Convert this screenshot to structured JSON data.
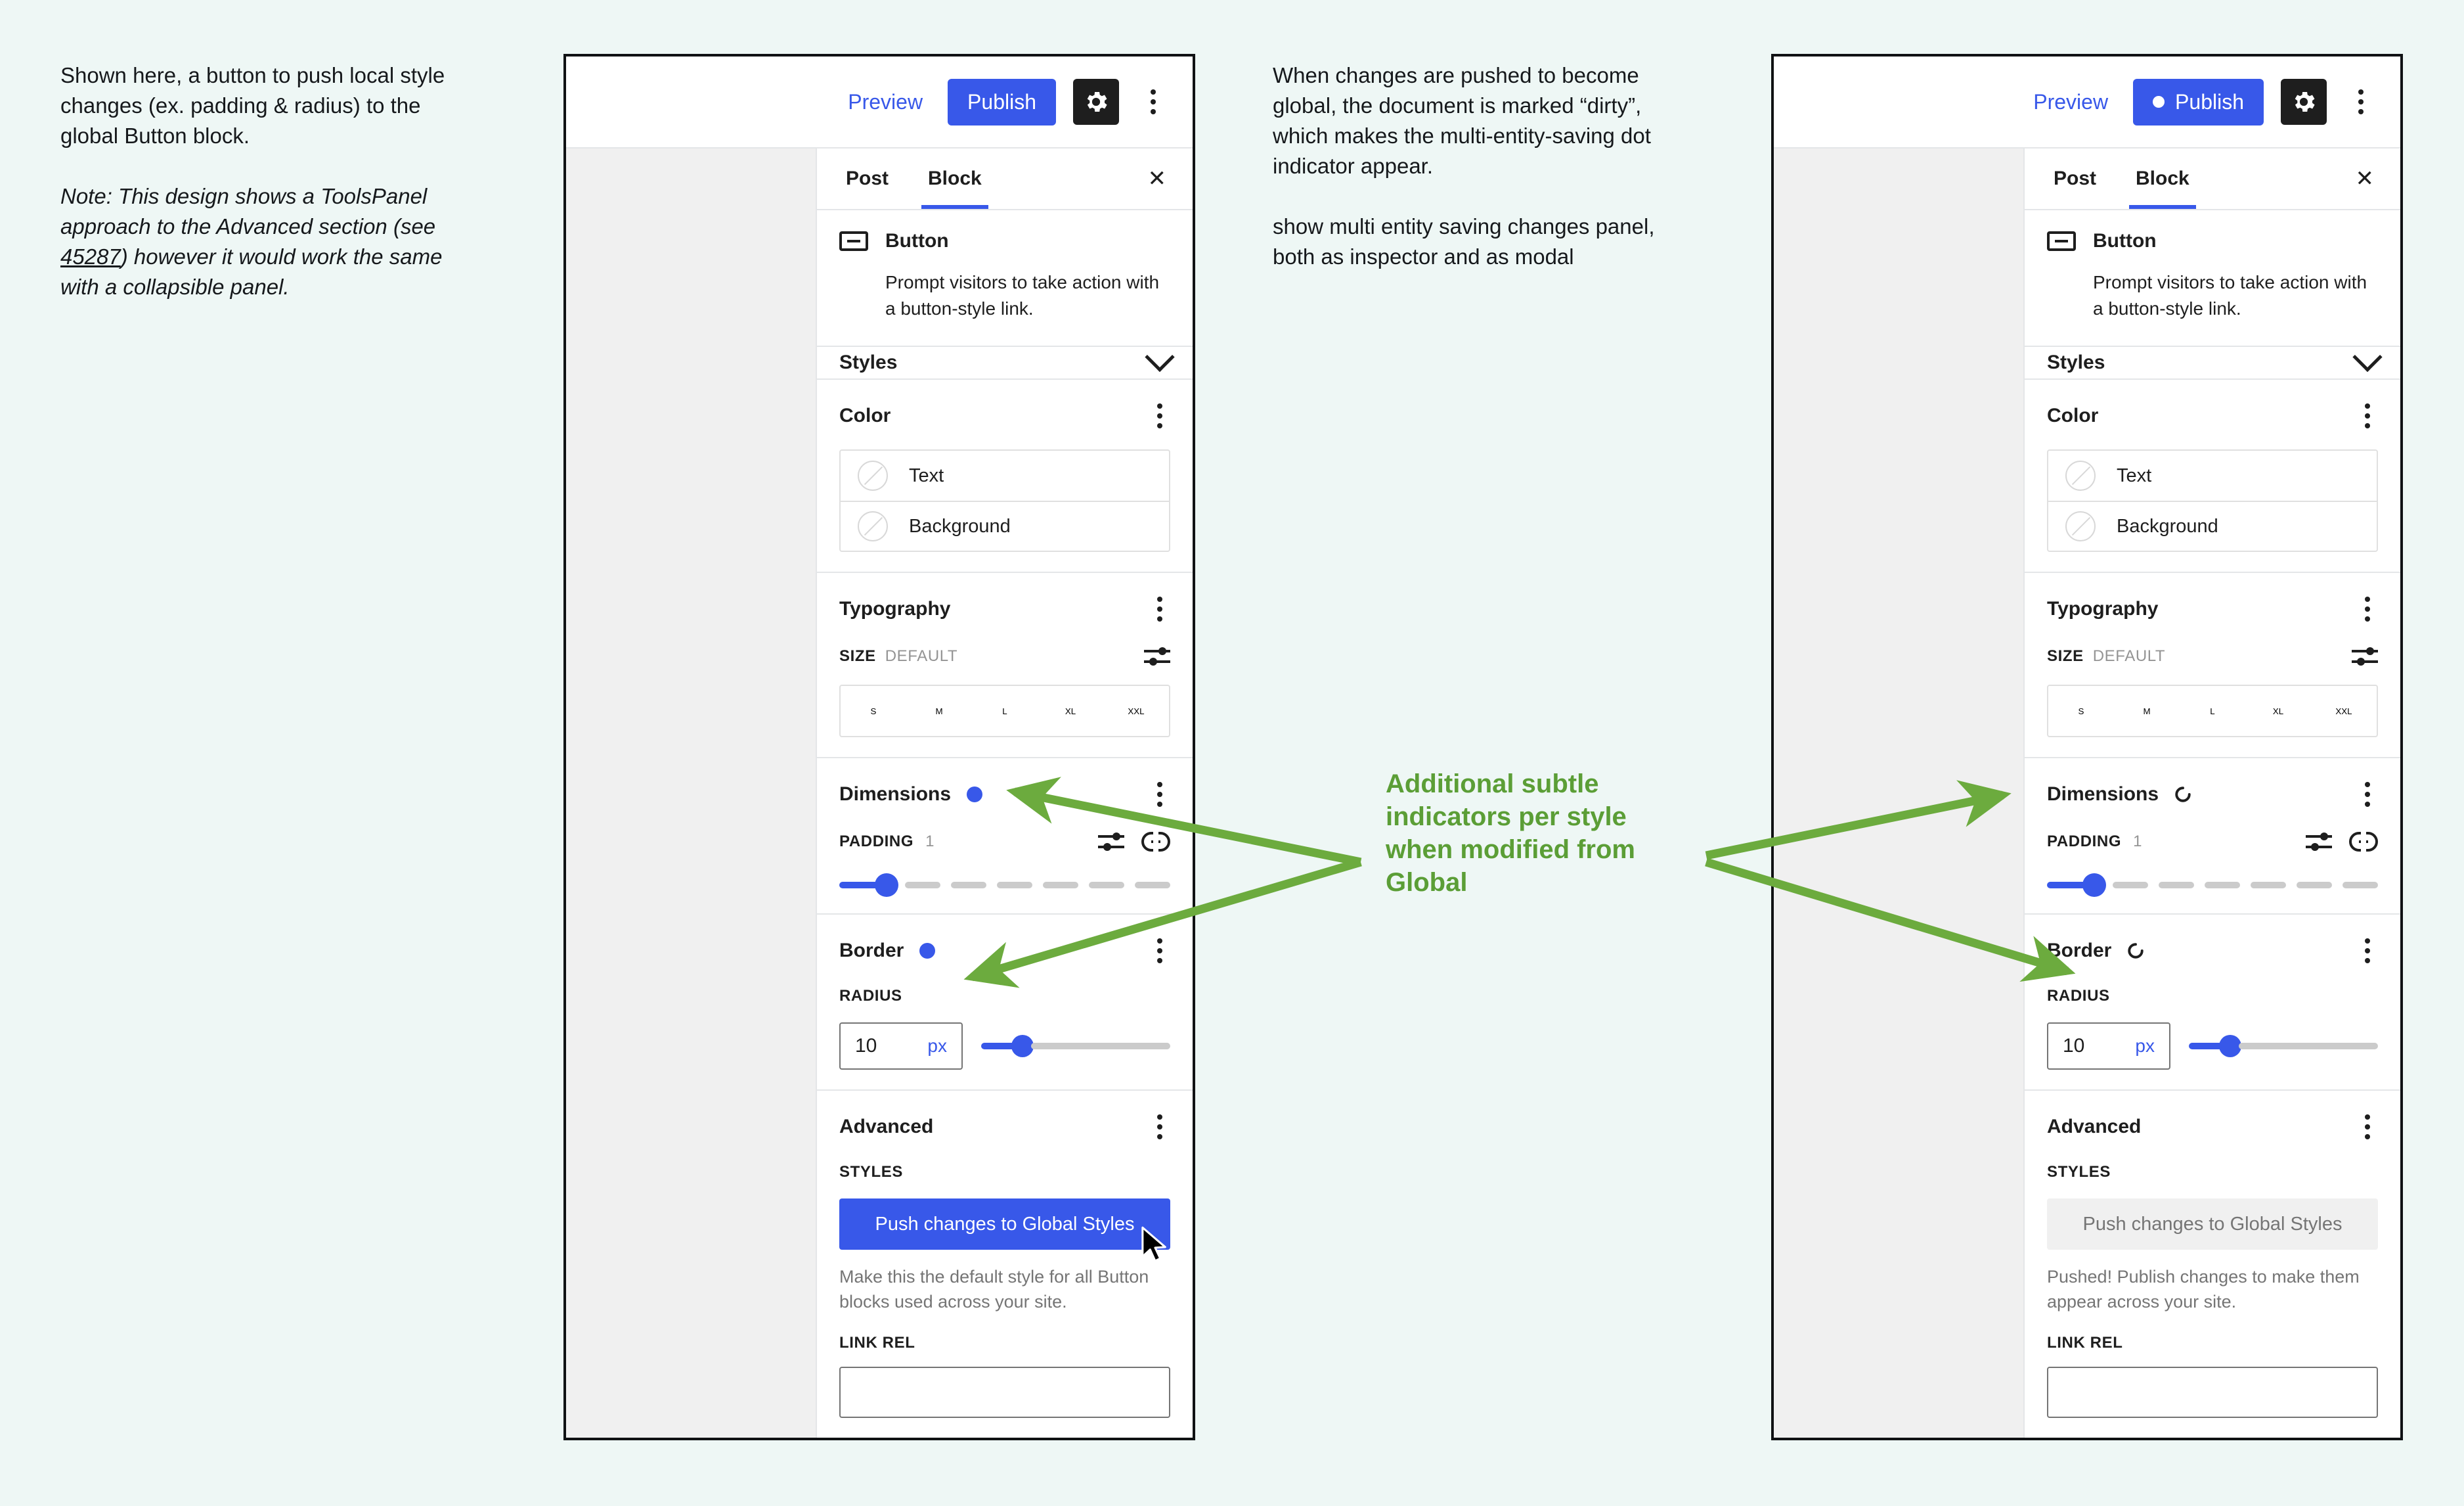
{
  "annotations": {
    "left": {
      "para1": "Shown here, a button to push local style changes (ex. padding & radius) to the global Button block.",
      "note_pre": "Note: This design shows a ToolsPanel approach to the Advanced section (see ",
      "note_link": "45287",
      "note_post": ") however it would work the same with a collapsible panel."
    },
    "middle": {
      "para1": "When changes are pushed to become global, the document is marked “dirty”, which makes the multi-entity-saving dot indicator appear.",
      "para2": "show multi entity saving changes panel, both as inspector and as modal"
    },
    "center_callout": {
      "text": "Additional subtle indicators per style when modified from Global",
      "color": "#5b9e36"
    }
  },
  "colors": {
    "page_bg": "#eef7f5",
    "accent_blue": "#3858e9",
    "callout_green": "#5b9e36",
    "canvas_gray": "#f0f0f0",
    "frame_border": "#101214"
  },
  "left_editor": {
    "header": {
      "preview_label": "Preview",
      "publish_label": "Publish",
      "publish_has_dot": false,
      "gear_icon": "gear-icon",
      "more_icon": "kebab-menu-icon"
    },
    "tabs": [
      {
        "label": "Post",
        "active": false
      },
      {
        "label": "Block",
        "active": true
      }
    ],
    "close_label": "✕",
    "block": {
      "icon": "button-block-icon",
      "name": "Button",
      "description": "Prompt visitors to take action with a button-style link."
    },
    "styles_panel": {
      "label": "Styles",
      "chevron": "chevron-down-icon"
    },
    "color": {
      "title": "Color",
      "rows": [
        {
          "label": "Text",
          "swatch": "none"
        },
        {
          "label": "Background",
          "swatch": "none"
        }
      ]
    },
    "typography": {
      "title": "Typography",
      "size_label": "SIZE",
      "size_value": "DEFAULT",
      "sizes": [
        "S",
        "M",
        "L",
        "XL",
        "XXL"
      ],
      "toggle_icon": "sliders-icon"
    },
    "dimensions": {
      "title": "Dimensions",
      "indicator": "filled-dot",
      "padding_label": "PADDING",
      "padding_value": "1",
      "sliders_icon": "sliders-icon",
      "link_icon": "link-sides-icon",
      "slider_fill_percent": 12
    },
    "border": {
      "title": "Border",
      "indicator": "filled-dot",
      "radius_label": "RADIUS",
      "radius_value": "10",
      "radius_unit": "px",
      "slider_fill_percent": 18
    },
    "advanced": {
      "title": "Advanced",
      "styles_label": "STYLES",
      "push_button_label": "Push changes to Global Styles",
      "push_button_state": "enabled",
      "help_text": "Make this the default style for all Button blocks used across your site.",
      "link_rel_label": "LINK REL",
      "link_rel_value": ""
    }
  },
  "right_editor": {
    "header": {
      "preview_label": "Preview",
      "publish_label": "Publish",
      "publish_has_dot": true,
      "gear_icon": "gear-icon",
      "more_icon": "kebab-menu-icon"
    },
    "tabs": [
      {
        "label": "Post",
        "active": false
      },
      {
        "label": "Block",
        "active": true
      }
    ],
    "close_label": "✕",
    "block": {
      "icon": "button-block-icon",
      "name": "Button",
      "description": "Prompt visitors to take action with a button-style link."
    },
    "styles_panel": {
      "label": "Styles",
      "chevron": "chevron-down-icon"
    },
    "color": {
      "title": "Color",
      "rows": [
        {
          "label": "Text",
          "swatch": "none"
        },
        {
          "label": "Background",
          "swatch": "none"
        }
      ]
    },
    "typography": {
      "title": "Typography",
      "size_label": "SIZE",
      "size_value": "DEFAULT",
      "sizes": [
        "S",
        "M",
        "L",
        "XL",
        "XXL"
      ],
      "toggle_icon": "sliders-icon"
    },
    "dimensions": {
      "title": "Dimensions",
      "indicator": "hollow-circle",
      "padding_label": "PADDING",
      "padding_value": "1",
      "sliders_icon": "sliders-icon",
      "link_icon": "link-sides-icon",
      "slider_fill_percent": 12
    },
    "border": {
      "title": "Border",
      "indicator": "hollow-circle",
      "radius_label": "RADIUS",
      "radius_value": "10",
      "radius_unit": "px",
      "slider_fill_percent": 18
    },
    "advanced": {
      "title": "Advanced",
      "styles_label": "STYLES",
      "push_button_label": "Push changes to Global Styles",
      "push_button_state": "disabled",
      "help_text": "Pushed! Publish changes to make them appear across your site.",
      "link_rel_label": "LINK REL",
      "link_rel_value": ""
    }
  }
}
